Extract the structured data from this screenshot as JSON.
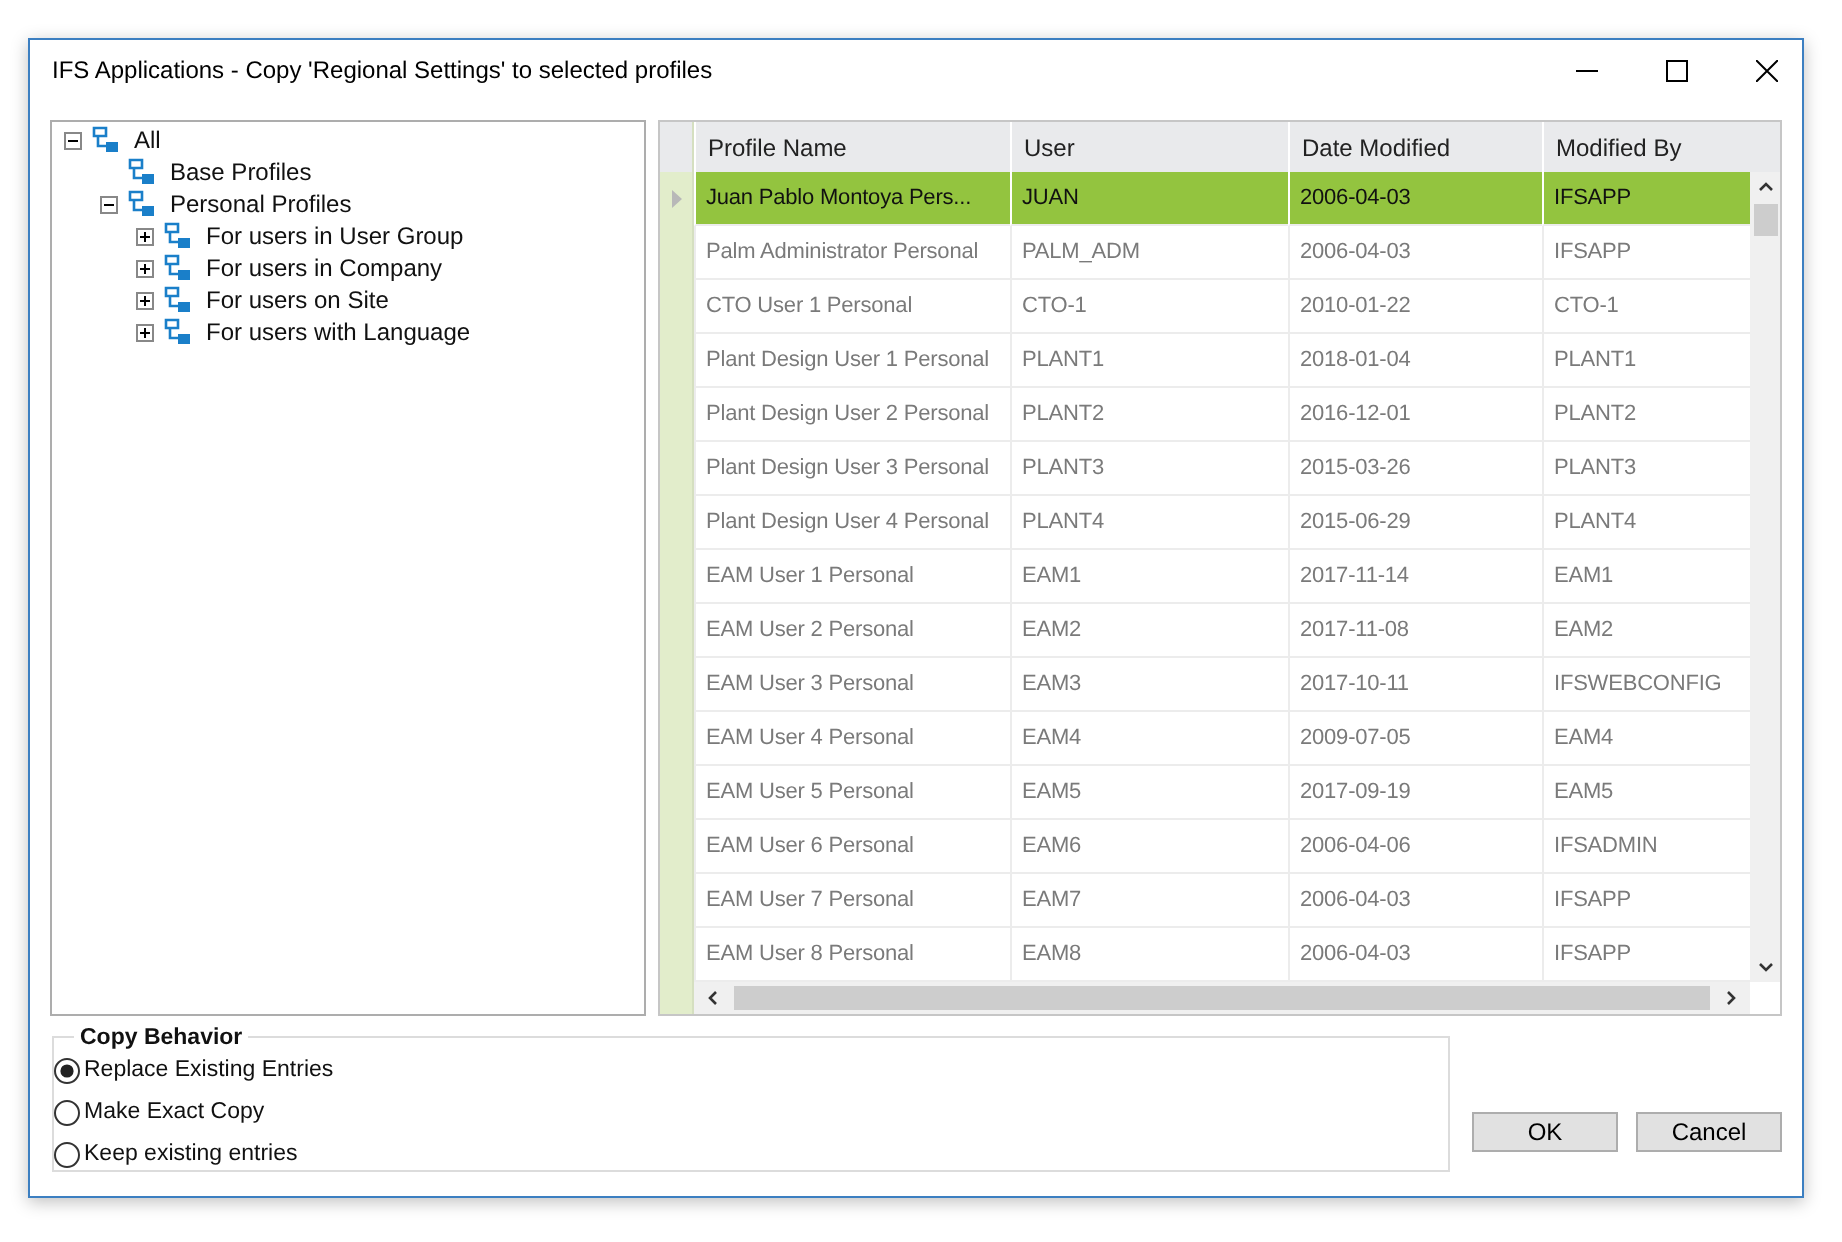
{
  "window": {
    "title": "IFS Applications - Copy 'Regional Settings' to selected profiles"
  },
  "tree": [
    {
      "label": "All",
      "expanded": true,
      "children": [
        {
          "label": "Base Profiles"
        },
        {
          "label": "Personal Profiles",
          "expanded": true,
          "children": [
            {
              "label": "For users in User Group",
              "expanded": false
            },
            {
              "label": "For users in Company",
              "expanded": false
            },
            {
              "label": "For users on Site",
              "expanded": false
            },
            {
              "label": "For users with Language",
              "expanded": false
            }
          ]
        }
      ]
    }
  ],
  "table": {
    "columns": [
      "Profile Name",
      "User",
      "Date Modified",
      "Modified By"
    ],
    "rows": [
      {
        "selected": true,
        "cells": [
          "Juan Pablo Montoya Pers...",
          "JUAN",
          "2006-04-03",
          "IFSAPP"
        ]
      },
      {
        "selected": false,
        "cells": [
          "Palm Administrator Personal",
          "PALM_ADM",
          "2006-04-03",
          "IFSAPP"
        ]
      },
      {
        "selected": false,
        "cells": [
          "CTO User 1 Personal",
          "CTO-1",
          "2010-01-22",
          "CTO-1"
        ]
      },
      {
        "selected": false,
        "cells": [
          "Plant Design User 1 Personal",
          "PLANT1",
          "2018-01-04",
          "PLANT1"
        ]
      },
      {
        "selected": false,
        "cells": [
          "Plant Design User 2 Personal",
          "PLANT2",
          "2016-12-01",
          "PLANT2"
        ]
      },
      {
        "selected": false,
        "cells": [
          "Plant Design User 3 Personal",
          "PLANT3",
          "2015-03-26",
          "PLANT3"
        ]
      },
      {
        "selected": false,
        "cells": [
          "Plant Design User 4 Personal",
          "PLANT4",
          "2015-06-29",
          "PLANT4"
        ]
      },
      {
        "selected": false,
        "cells": [
          "EAM User 1 Personal",
          "EAM1",
          "2017-11-14",
          "EAM1"
        ]
      },
      {
        "selected": false,
        "cells": [
          "EAM User 2 Personal",
          "EAM2",
          "2017-11-08",
          "EAM2"
        ]
      },
      {
        "selected": false,
        "cells": [
          "EAM User 3 Personal",
          "EAM3",
          "2017-10-11",
          "IFSWEBCONFIG"
        ]
      },
      {
        "selected": false,
        "cells": [
          "EAM User 4 Personal",
          "EAM4",
          "2009-07-05",
          "EAM4"
        ]
      },
      {
        "selected": false,
        "cells": [
          "EAM User 5 Personal",
          "EAM5",
          "2017-09-19",
          "EAM5"
        ]
      },
      {
        "selected": false,
        "cells": [
          "EAM User 6 Personal",
          "EAM6",
          "2006-04-06",
          "IFSADMIN"
        ]
      },
      {
        "selected": false,
        "cells": [
          "EAM User 7 Personal",
          "EAM7",
          "2006-04-03",
          "IFSAPP"
        ]
      },
      {
        "selected": false,
        "cells": [
          "EAM User 8 Personal",
          "EAM8",
          "2006-04-03",
          "IFSAPP"
        ]
      }
    ]
  },
  "copy_behavior": {
    "title": "Copy Behavior",
    "options": [
      {
        "label": "Replace Existing Entries",
        "selected": true
      },
      {
        "label": "Make Exact Copy",
        "selected": false
      },
      {
        "label": "Keep existing entries",
        "selected": false
      }
    ]
  },
  "buttons": [
    "OK",
    "Cancel"
  ]
}
